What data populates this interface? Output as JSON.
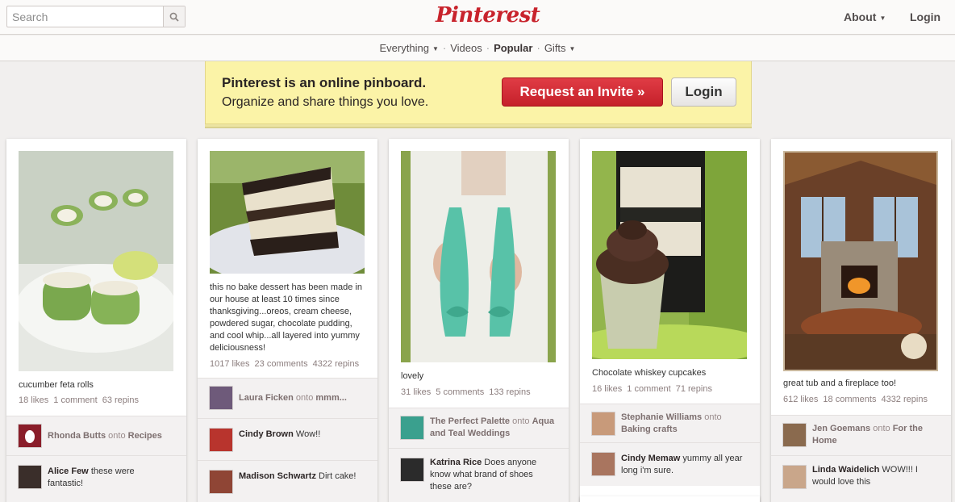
{
  "header": {
    "search_placeholder": "Search",
    "logo": "Pinterest",
    "about": "About",
    "login": "Login"
  },
  "subnav": {
    "everything": "Everything",
    "videos": "Videos",
    "popular": "Popular",
    "gifts": "Gifts"
  },
  "banner": {
    "line1": "Pinterest is an online pinboard.",
    "line2": "Organize and share things you love.",
    "invite": "Request an Invite »",
    "login": "Login"
  },
  "pins": [
    {
      "desc": "cucumber feta rolls",
      "likes": "18 likes",
      "comments": "1 comment",
      "repins": "63 repins",
      "pinner": {
        "name": "Rhonda Butts",
        "onto": "onto",
        "board": "Recipes"
      },
      "comment": {
        "name": "Alice Few",
        "text": "these were fantastic!"
      }
    },
    {
      "desc": "this no bake dessert has been made in our house at least 10 times since thanksgiving...oreos, cream cheese, powdered sugar, chocolate pudding, and cool whip...all layered into yummy deliciousness!",
      "likes": "1017 likes",
      "comments": "23 comments",
      "repins": "4322 repins",
      "pinner": {
        "name": "Laura Ficken",
        "onto": "onto",
        "board": "mmm..."
      },
      "comments_list": [
        {
          "name": "Cindy Brown",
          "text": "Wow!!"
        },
        {
          "name": "Madison Schwartz",
          "text": "Dirt cake!"
        }
      ]
    },
    {
      "desc": "lovely",
      "likes": "31 likes",
      "comments": "5 comments",
      "repins": "133 repins",
      "pinner": {
        "name": "The Perfect Palette",
        "onto": "onto",
        "board": "Aqua and Teal Weddings"
      },
      "comment": {
        "name": "Katrina Rice",
        "text": "Does anyone know what brand of shoes these are?"
      }
    },
    {
      "desc": "Chocolate whiskey cupcakes",
      "likes": "16 likes",
      "comments": "1 comment",
      "repins": "71 repins",
      "pinner": {
        "name": "Stephanie Williams",
        "onto": "onto",
        "board": "Baking crafts"
      },
      "comment": {
        "name": "Cindy Memaw",
        "text": "yummy all year long i'm sure."
      }
    },
    {
      "desc": "great tub and a fireplace too!",
      "likes": "612 likes",
      "comments": "18 comments",
      "repins": "4332 repins",
      "pinner": {
        "name": "Jen Goemans",
        "onto": "onto",
        "board": "For the Home"
      },
      "comment": {
        "name": "Linda Waidelich",
        "text": "WOW!!! I would love this"
      }
    }
  ],
  "colors": {
    "brand_red": "#c8232c",
    "banner_yellow": "#fbf3a7"
  }
}
